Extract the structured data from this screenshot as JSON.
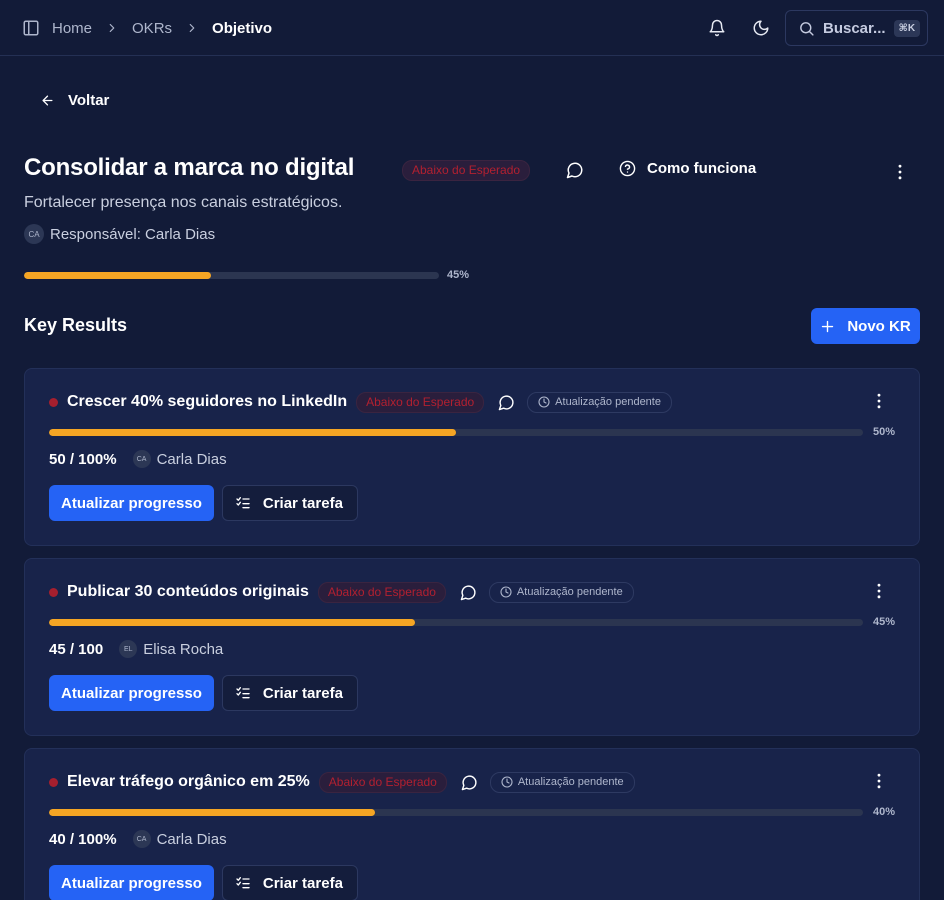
{
  "topbar": {
    "breadcrumb": [
      "Home",
      "OKRs",
      "Objetivo"
    ],
    "search_label": "Buscar...",
    "search_shortcut": "⌘K"
  },
  "back_label": "Voltar",
  "objective": {
    "title": "Consolidar a marca no digital",
    "status": "Abaixo do Esperado",
    "how_it_works": "Como funciona",
    "description": "Fortalecer presença nos canais estratégicos.",
    "owner_initials": "CA",
    "owner_label": "Responsável: Carla Dias",
    "progress": 45,
    "progress_label": "45%"
  },
  "key_results_heading": "Key Results",
  "new_kr_label": "Novo KR",
  "key_results": [
    {
      "title": "Crescer 40% seguidores no LinkedIn",
      "status": "Abaixo do Esperado",
      "pending": "Atualização pendente",
      "progress": 50,
      "progress_label": "50%",
      "value": "50 / 100%",
      "owner_initials": "CA",
      "owner": "Carla Dias",
      "update_label": "Atualizar progresso",
      "task_label": "Criar tarefa"
    },
    {
      "title": "Publicar 30 conteúdos originais",
      "status": "Abaixo do Esperado",
      "pending": "Atualização pendente",
      "progress": 45,
      "progress_label": "45%",
      "value": "45 / 100",
      "owner_initials": "EL",
      "owner": "Elisa Rocha",
      "update_label": "Atualizar progresso",
      "task_label": "Criar tarefa"
    },
    {
      "title": "Elevar tráfego orgânico em 25%",
      "status": "Abaixo do Esperado",
      "pending": "Atualização pendente",
      "progress": 40,
      "progress_label": "40%",
      "value": "40 / 100%",
      "owner_initials": "CA",
      "owner": "Carla Dias",
      "update_label": "Atualizar progresso",
      "task_label": "Criar tarefa"
    }
  ],
  "colors": {
    "background": "#121b38",
    "card": "#18234a",
    "accent": "#2563f5",
    "progress": "#f5a524",
    "danger": "#a61f2e"
  },
  "icons": [
    "sidebar-toggle-icon",
    "chevron-right-icon",
    "bell-icon",
    "moon-icon",
    "search-icon",
    "arrow-left-icon",
    "message-circle-icon",
    "help-circle-icon",
    "more-vertical-icon",
    "plus-icon",
    "clock-icon",
    "list-checks-icon"
  ]
}
